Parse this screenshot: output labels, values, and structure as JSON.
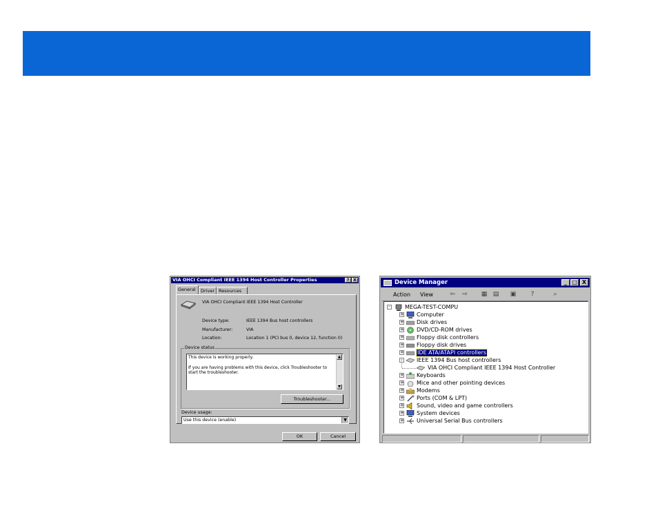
{
  "props_dialog": {
    "title": "VIA OHCI Compliant IEEE 1394 Host Controller Properties",
    "title_buttons": [
      "?",
      "X"
    ],
    "tabs": [
      "General",
      "Driver",
      "Resources"
    ],
    "device_name": "VIA OHCI Compliant IEEE 1394 Host Controller",
    "device_type_label": "Device type:",
    "device_type_value": "IEEE 1394 Bus host controllers",
    "manufacturer_label": "Manufacturer:",
    "manufacturer_value": "VIA",
    "location_label": "Location:",
    "location_value": "Location 1 (PCI bus 0, device 12, function 0)",
    "status_group_label": "Device status",
    "status_line1": "This device is working properly.",
    "status_line2": "If you are having problems with this device, click Troubleshooter to",
    "status_line3": "start the troubleshooter.",
    "troubleshooter_button": "Troubleshooter...",
    "usage_label": "Device usage:",
    "usage_value": "Use this device (enable)",
    "ok_button": "OK",
    "cancel_button": "Cancel"
  },
  "device_manager": {
    "title": "Device Manager",
    "title_buttons": [
      "_",
      "□",
      "X"
    ],
    "menu": {
      "action": "Action",
      "view": "View"
    },
    "toolbar_icons": [
      "back-arrow-icon",
      "forward-arrow-icon",
      "tree-view-icon",
      "list-view-icon",
      "properties-icon",
      "help-icon",
      "scan-hardware-icon"
    ],
    "tree": [
      {
        "label": "MEGA-TEST-COMPU",
        "level": 0,
        "expander": "-",
        "icon": "computer-root-icon"
      },
      {
        "label": "Computer",
        "level": 1,
        "expander": "+",
        "icon": "computer-icon"
      },
      {
        "label": "Disk drives",
        "level": 1,
        "expander": "+",
        "icon": "disk-drive-icon"
      },
      {
        "label": "DVD/CD-ROM drives",
        "level": 1,
        "expander": "+",
        "icon": "cdrom-icon"
      },
      {
        "label": "Floppy disk controllers",
        "level": 1,
        "expander": "+",
        "icon": "controller-icon"
      },
      {
        "label": "Floppy disk drives",
        "level": 1,
        "expander": "+",
        "icon": "floppy-icon"
      },
      {
        "label": "IDE ATA/ATAPI controllers",
        "level": 1,
        "expander": "+",
        "icon": "ide-controller-icon",
        "selected": true
      },
      {
        "label": "IEEE 1394 Bus host controllers",
        "level": 1,
        "expander": "-",
        "icon": "ieee1394-icon"
      },
      {
        "label": "VIA OHCI Compliant IEEE 1394 Host Controller",
        "level": 2,
        "expander": "",
        "icon": "ieee1394-device-icon"
      },
      {
        "label": "Keyboards",
        "level": 1,
        "expander": "+",
        "icon": "keyboard-icon"
      },
      {
        "label": "Mice and other pointing devices",
        "level": 1,
        "expander": "+",
        "icon": "mouse-icon"
      },
      {
        "label": "Modems",
        "level": 1,
        "expander": "+",
        "icon": "modem-icon"
      },
      {
        "label": "Ports (COM & LPT)",
        "level": 1,
        "expander": "+",
        "icon": "port-icon"
      },
      {
        "label": "Sound, video and game controllers",
        "level": 1,
        "expander": "+",
        "icon": "sound-icon"
      },
      {
        "label": "System devices",
        "level": 1,
        "expander": "+",
        "icon": "system-device-icon"
      },
      {
        "label": "Universal Serial Bus controllers",
        "level": 1,
        "expander": "+",
        "icon": "usb-icon"
      }
    ]
  },
  "colors": {
    "banner": "#0a66d4",
    "window_face": "#c0c0c0",
    "title_bar": "#000080"
  }
}
